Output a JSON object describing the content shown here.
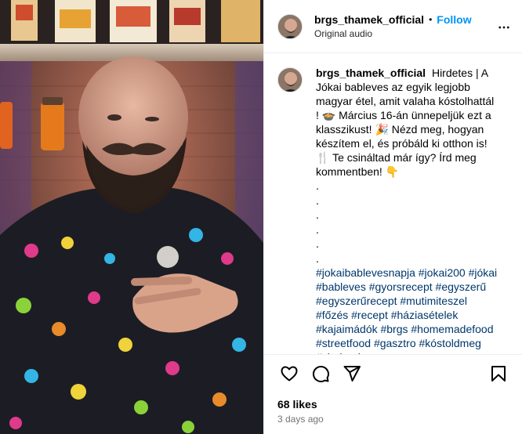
{
  "header": {
    "username": "brgs_thamek_official",
    "separator": "•",
    "follow_label": "Follow",
    "audio_label": "Original audio",
    "more_icon": "more-horizontal-icon"
  },
  "caption": {
    "username": "brgs_thamek_official",
    "text": "Hirdetes | A Jókai bableves az egyik legjobb magyar étel, amit valaha kóstolhattál ! 🍲 Március 16-án ünnepeljük ezt a klasszikust! 🎉 Nézd meg, hogyan készítem el, és próbáld ki otthon is! 🍴 Te csináltad már így? Írd meg kommentben! 👇",
    "dots": [
      ".",
      ".",
      ".",
      ".",
      ".",
      "."
    ],
    "hashtags": "#jokaibablevesnapja #jokai200 #jókai #bableves #gyorsrecept #egyszerű #egyszerűrecept #mutimiteszel #főzés #recept #háziasételek #kajaimádók #brgs #homemadefood #streetfood #gasztro #kóstoldmeg #viralreels"
  },
  "actions": {
    "like_icon": "heart-icon",
    "comment_icon": "comment-icon",
    "share_icon": "share-icon",
    "save_icon": "bookmark-icon"
  },
  "likes_text": "68 likes",
  "date_text": "3 days ago",
  "colors": {
    "follow": "#0095f6",
    "hashtag": "#00376b",
    "muted": "#737373"
  }
}
